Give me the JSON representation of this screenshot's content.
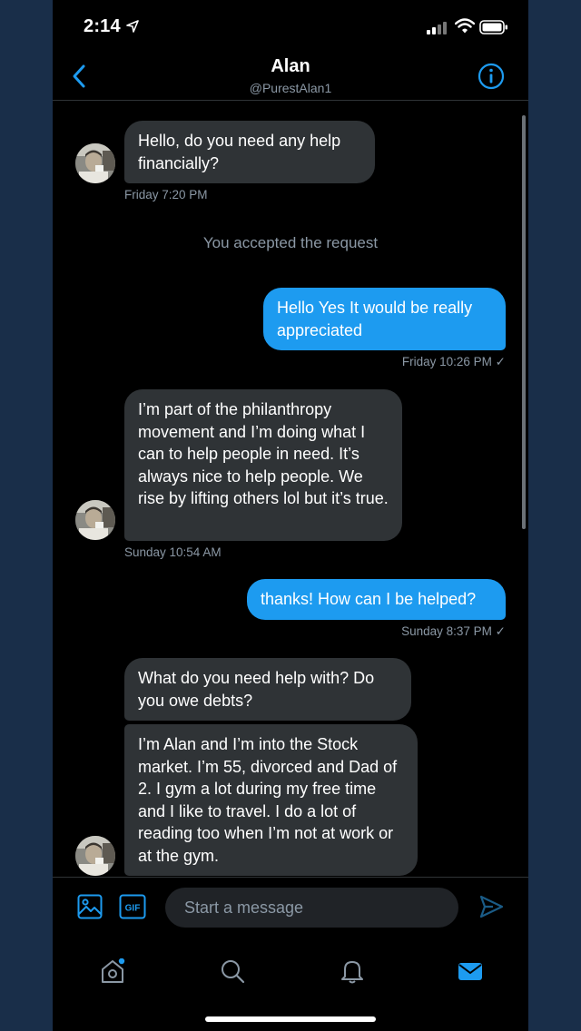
{
  "status": {
    "time": "2:14"
  },
  "header": {
    "name": "Alan",
    "handle": "@PurestAlan1"
  },
  "messages": {
    "m1": "Hello, do you need any help financially?",
    "m1_time": "Friday 7:20 PM",
    "system": "You accepted the request",
    "m2": "Hello Yes It would be really appreciated",
    "m2_time": "Friday 10:26 PM ✓",
    "m3": "I’m part of the philanthropy movement and I’m doing what I can to help people in need. It’s always nice to help people. We rise by lifting others lol but it’s true.",
    "m3_time": "Sunday 10:54 AM",
    "m4": "thanks! How can I be helped?",
    "m4_time": "Sunday 8:37 PM ✓",
    "m5": "What do you need help with? Do you owe debts?",
    "m6": "I’m  Alan and I’m into the Stock market. I’m 55, divorced and Dad of 2. I gym a lot during my free time and I like to travel. I do a lot of reading too when I’m not at work or at the gym."
  },
  "composer": {
    "placeholder": "Start a message",
    "gif_label": "GIF"
  },
  "colors": {
    "accent": "#1d9bf0",
    "incoming_bubble": "#2f3336",
    "background": "#000000",
    "muted": "#8b98a5"
  },
  "tabbar": {
    "active": "messages"
  }
}
